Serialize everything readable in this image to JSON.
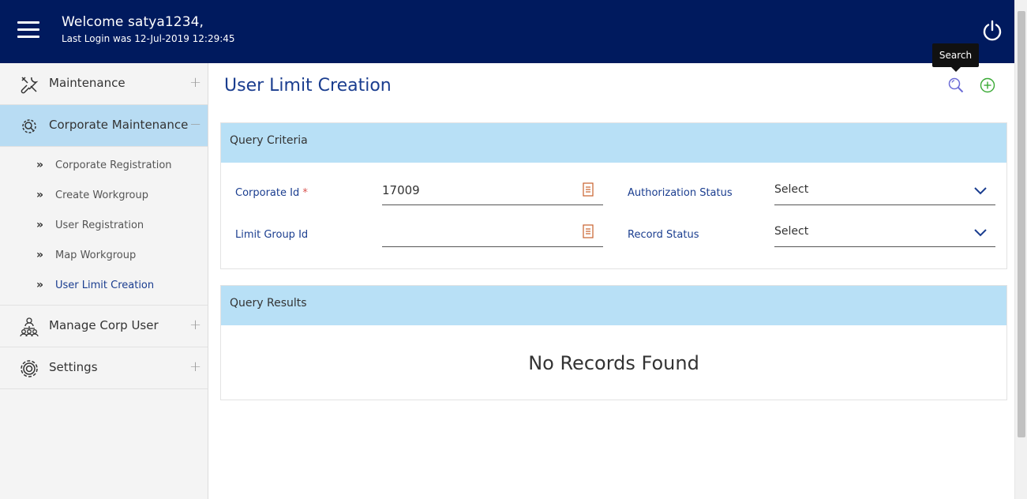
{
  "header": {
    "welcome": "Welcome satya1234,",
    "last_login": "Last Login was 12-Jul-2019 12:29:45",
    "menu_icon": "hamburger-icon",
    "power_icon": "power-icon",
    "background": "#001a5e"
  },
  "sidebar": {
    "items": [
      {
        "label": "Maintenance",
        "icon": "tools-icon",
        "toggle": "+"
      },
      {
        "label": "Corporate Maintenance",
        "icon": "gear-search-icon",
        "toggle": "−"
      },
      {
        "label": "Manage Corp User",
        "icon": "users-hierarchy-icon",
        "toggle": "+"
      },
      {
        "label": "Settings",
        "icon": "gear-icon",
        "toggle": "+"
      }
    ],
    "subitems": [
      {
        "label": "Corporate Registration",
        "arrow": "»"
      },
      {
        "label": "Create Workgroup",
        "arrow": "»"
      },
      {
        "label": "User Registration",
        "arrow": "»"
      },
      {
        "label": "Map Workgroup",
        "arrow": "»"
      },
      {
        "label": "User Limit Creation",
        "arrow": "»"
      }
    ],
    "active_color": "#b8dcf3"
  },
  "main": {
    "title": "User Limit Creation",
    "tooltip": "Search",
    "criteria": {
      "heading": "Query Criteria",
      "corporate_id_label": "Corporate Id",
      "required_mark": "*",
      "corporate_id_value": "17009",
      "limit_group_label": "Limit Group Id",
      "limit_group_value": "",
      "auth_status_label": "Authorization Status",
      "auth_status_value": "Select",
      "record_status_label": "Record Status",
      "record_status_value": "Select"
    },
    "results": {
      "heading": "Query Results",
      "empty_text": "No Records Found"
    },
    "panel_header_color": "#b8e0f6",
    "accent_color": "#1a3d8f"
  }
}
